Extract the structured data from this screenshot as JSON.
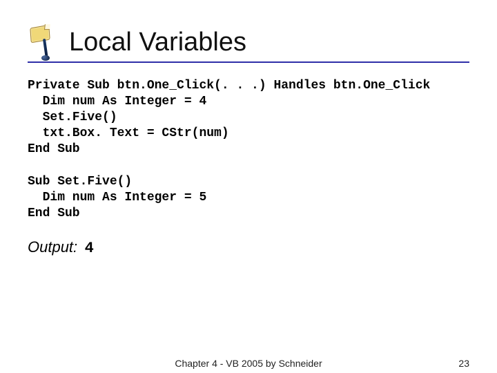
{
  "header": {
    "title": "Local Variables"
  },
  "code": {
    "block1": "Private Sub btn.One_Click(. . .) Handles btn.One_Click\n  Dim num As Integer = 4\n  Set.Five()\n  txt.Box. Text = CStr(num)\nEnd Sub",
    "block2": "Sub Set.Five()\n  Dim num As Integer = 5\nEnd Sub"
  },
  "output": {
    "label": "Output:",
    "value": "4"
  },
  "footer": {
    "center": "Chapter 4 - VB 2005 by Schneider",
    "page_number": "23"
  }
}
